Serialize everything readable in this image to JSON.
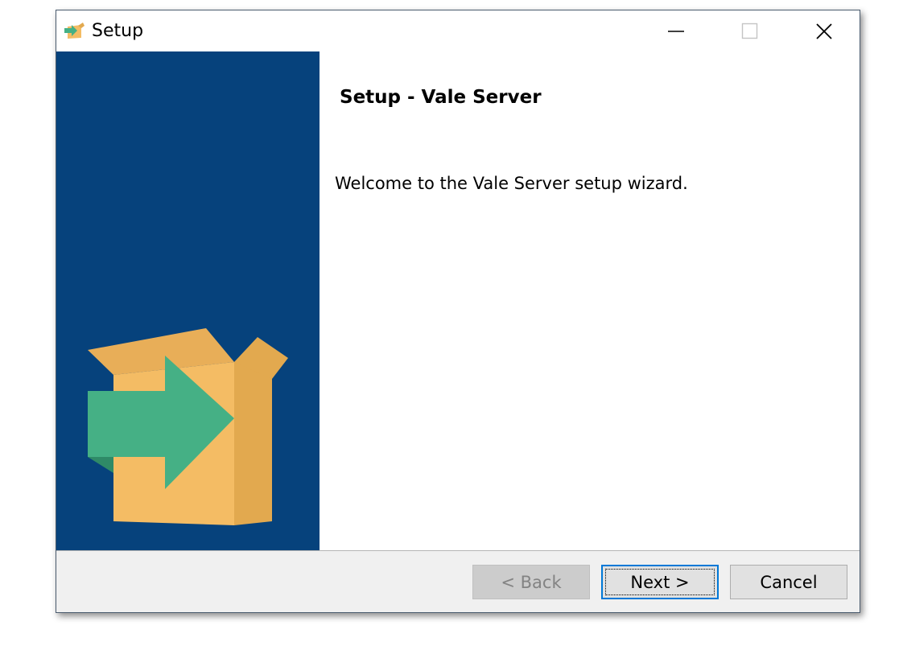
{
  "window": {
    "title": "Setup",
    "icon": "setup-box-icon"
  },
  "controls": {
    "minimize_icon": "minimize-icon",
    "maximize_icon": "maximize-icon",
    "close_icon": "close-icon"
  },
  "content": {
    "heading": "Setup - Vale Server",
    "welcome": "Welcome to the Vale Server setup wizard."
  },
  "buttons": {
    "back": "< Back",
    "next": "Next >",
    "cancel": "Cancel"
  },
  "colors": {
    "sidebar": "#06427c",
    "box": "#f4bc64",
    "arrow": "#45b085"
  }
}
